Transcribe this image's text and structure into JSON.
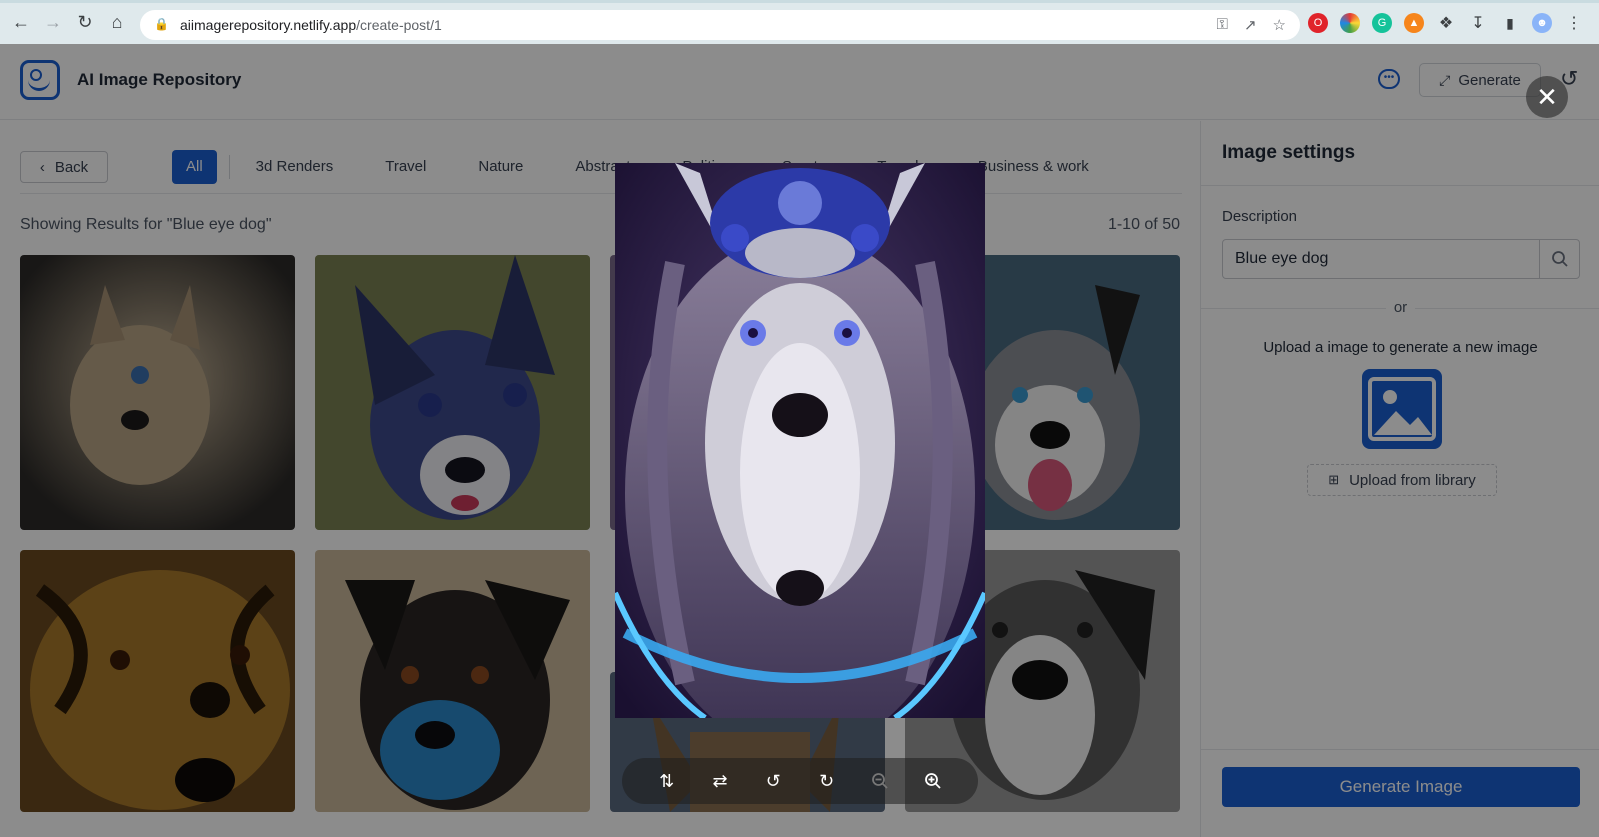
{
  "browser": {
    "url_host": "aiimagerepository.netlify.app",
    "url_path": "/create-post/1"
  },
  "header": {
    "app_title": "AI Image Repository",
    "generate_label": "Generate"
  },
  "content": {
    "back_label": "Back",
    "categories": [
      "All",
      "3d Renders",
      "Travel",
      "Nature",
      "Abstract",
      "Politics",
      "Sports",
      "Travels",
      "Business & work"
    ],
    "active_category": "All",
    "results_text": "Showing Results for \"Blue eye dog\"",
    "results_count": "1-10 of 50"
  },
  "panel": {
    "title": "Image settings",
    "description_label": "Description",
    "description_value": "Blue eye dog",
    "or_text": "or",
    "upload_text": "Upload a image to generate a new image",
    "upload_library_label": "Upload from library",
    "generate_image_label": "Generate Image"
  },
  "colors": {
    "accent": "#1a5fd1",
    "overlay": "rgba(0,0,0,0.45)"
  },
  "preview_toolbar": {
    "tools": [
      "flip-vertical-icon",
      "flip-horizontal-icon",
      "rotate-left-icon",
      "rotate-right-icon",
      "zoom-out-icon",
      "zoom-in-icon"
    ]
  }
}
